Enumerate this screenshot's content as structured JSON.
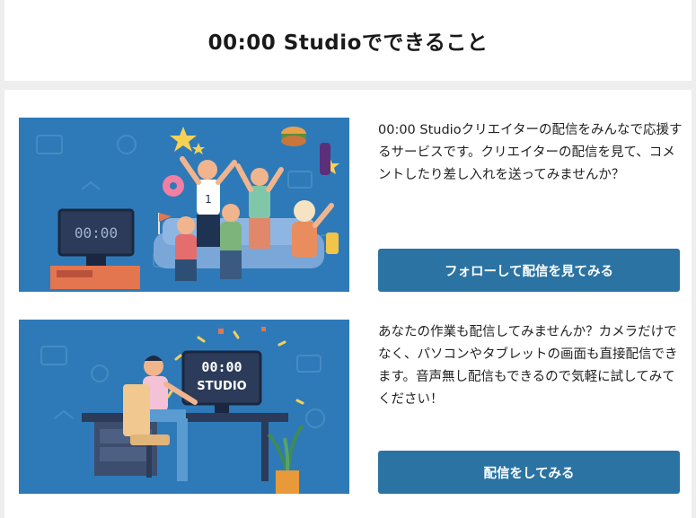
{
  "header": {
    "title": "00:00 Studioでできること"
  },
  "features": [
    {
      "description": "00:00 Studioクリエイターの配信をみんなで応援するサービスです。クリエイターの配信を見て、コメントしたり差し入れを送ってみませんか？",
      "button_label": "フォローして配信を見てみる",
      "tv_text": "00:00"
    },
    {
      "description": "あなたの作業も配信してみませんか？カメラだけでなく、パソコンやタブレットの画面も直接配信できます。音声無し配信もできるので気軽に試してみてください！",
      "button_label": "配信をしてみる",
      "monitor_time": "00:00",
      "monitor_label": "STUDIO"
    }
  ],
  "colors": {
    "illustration_bg": "#2e7ab8",
    "button_bg": "#2a73a2",
    "button_text": "#ffffff"
  }
}
